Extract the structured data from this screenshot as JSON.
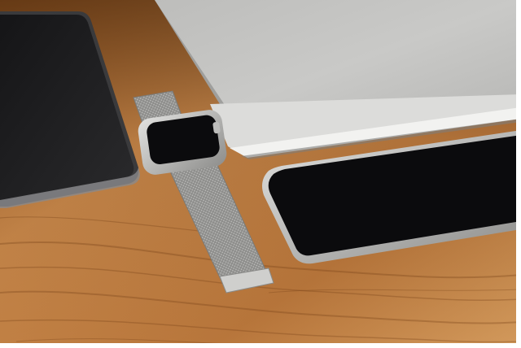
{
  "colors": {
    "wood_light": "#c7874a",
    "wood_mid": "#a8682f",
    "wood_dark": "#7a4519",
    "screen_black": "#0b0b0d",
    "aluminum": "#c9c9c7",
    "aluminum_dark": "#8f8f8d",
    "mesh": "#9a9a98"
  }
}
